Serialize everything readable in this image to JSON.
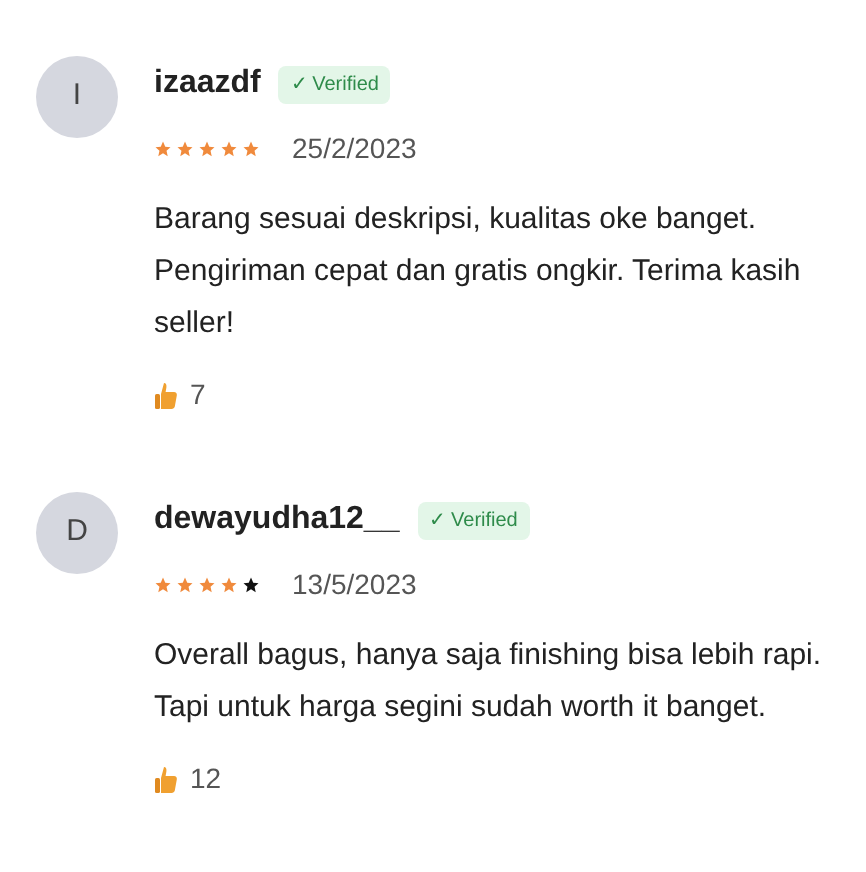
{
  "reviews": [
    {
      "initial": "I",
      "name": "izaazdf",
      "verified": "✓ Verified",
      "stars": 5,
      "date": "25/2/2023",
      "text": "Barang sesuai deskripsi, kualitas oke banget. Pengiriman cepat dan gratis ongkir. Terima kasih seller!",
      "likes": "7"
    },
    {
      "initial": "D",
      "name": "dewayudha12__",
      "verified": "✓ Verified",
      "stars": 4,
      "date": "13/5/2023",
      "text": "Overall bagus, hanya saja finishing bisa lebih rapi. Tapi untuk harga segini sudah worth it banget.",
      "likes": "12"
    }
  ]
}
